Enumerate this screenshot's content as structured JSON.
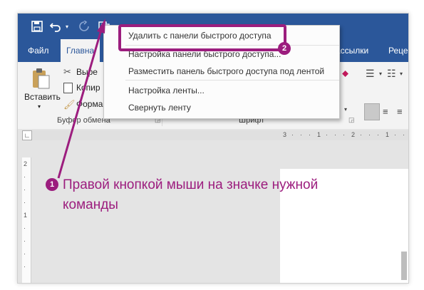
{
  "quick_access": {
    "icons": [
      "save-icon",
      "undo-icon",
      "redo-icon",
      "custom-command-icon"
    ]
  },
  "tabs": [
    {
      "label": "Файл"
    },
    {
      "label": "Главна"
    },
    {
      "label": "ассылки"
    },
    {
      "label": "Реце"
    }
  ],
  "ribbon": {
    "paste_label": "Вставить",
    "cut_label": "Выре",
    "copy_label": "Копир",
    "format_painter_label": "Форма",
    "clipboard_group": "Буфер обмена",
    "font_group": "Шрифт"
  },
  "context_menu": {
    "items": [
      {
        "label": "Удалить с панели быстрого доступа"
      },
      {
        "label": "Настройка панели быстрого доступа..."
      },
      {
        "label": "Разместить панель быстрого доступа под лентой"
      },
      {
        "label": "Настройка ленты..."
      },
      {
        "label": "Свернуть ленту"
      }
    ]
  },
  "ruler": {
    "h_marks": [
      "3",
      "·",
      "·",
      "·",
      "1",
      "·",
      "·",
      "·",
      "2",
      "·",
      "·",
      "·",
      "1",
      "·",
      "·"
    ],
    "v_marks": [
      "2",
      "·",
      "·",
      "·",
      "1",
      "·",
      "·",
      "·",
      "·"
    ]
  },
  "annotations": {
    "step1_number": "1",
    "step1_text": "Правой кнопкой мыши на значке нужной команды",
    "step2_number": "2"
  },
  "colors": {
    "title_bar": "#2b579a",
    "annotation": "#9c1d7e"
  }
}
